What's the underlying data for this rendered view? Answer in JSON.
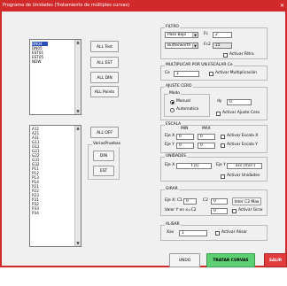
{
  "window": {
    "title": "Programa de Unidades (Tratamiento de múltiples curvas)",
    "close_glyph": "✕"
  },
  "top_list": {
    "items": [
      "DN04",
      "DN05",
      "EST01",
      "EST05",
      "NDW"
    ],
    "selected_index": 0
  },
  "top_buttons": {
    "all_test": "ALL Test",
    "all_est": "ALL EST",
    "all_din": "ALL DIN",
    "all_points": "ALL Points"
  },
  "bottom_list": {
    "items": [
      "A11",
      "A21",
      "A31",
      "G11",
      "G12",
      "G21",
      "G22",
      "G31",
      "G32",
      "P11",
      "P12",
      "P13",
      "P14",
      "P21",
      "P22",
      "P23",
      "P31",
      "P32",
      "P33",
      "P34"
    ]
  },
  "bottom_controls": {
    "all_off": "ALL OFF",
    "group_label": "VariasPruebas",
    "din": "DIN",
    "est": "EST"
  },
  "filtro": {
    "title": "FILTRO",
    "type_value": "Paso Bajo",
    "design_value": "Butterworth",
    "fc_label": "Fc",
    "fc_value": "2",
    "fc2_label": "Fc2",
    "fc2_value": "15",
    "activar": "Activar Filtro"
  },
  "mult": {
    "title": "MULTIPLICAR POR UN ESCALAR Ce",
    "ce_label": "Ce",
    "ce_value": "1",
    "activar": "Activar Multiplicación"
  },
  "ajuste": {
    "title": "AJUSTE CERO",
    "modo_title": "Modo",
    "manual": "Manual",
    "automatico": "Automatico",
    "dy_label": "dy",
    "dy_value": "0",
    "activar": "Activar Ajuste Cero"
  },
  "escala": {
    "title": "ESCALA",
    "min_label": "MIN",
    "max_label": "MAX",
    "ejex_label": "Eje X",
    "ejex_min": "0",
    "ejex_max": "0",
    "ejey_label": "Eje Y",
    "ejey_min": "0",
    "ejey_max": "0",
    "activar_x": "Activar Escala X",
    "activar_y": "Activar Escala Y"
  },
  "unidades": {
    "title": "UNIDADES",
    "ejex_label": "Eje X",
    "ejex_value": "t [s]",
    "ejey_label": "Eje Y",
    "ejey_value": "acc [m/s²]",
    "activar": "Activar Unidades"
  },
  "girar": {
    "title": "GIRAR",
    "c1_label": "Eje X: C1",
    "c1_value": "0",
    "c2_label": "C2",
    "c2_value": "0",
    "inter_button": "Inter C2 Max",
    "valor_label": "Valor Y en x=C2",
    "valor_value": "0",
    "activar": "Activar Girar"
  },
  "alisar": {
    "title": "ALISAR",
    "xav_label": "Xav",
    "xav_value": "1",
    "activar": "Activar Alisar"
  },
  "footer": {
    "undo": "UNDO",
    "tratar": "TRATAR CURVAS",
    "salir": "SALIR"
  }
}
